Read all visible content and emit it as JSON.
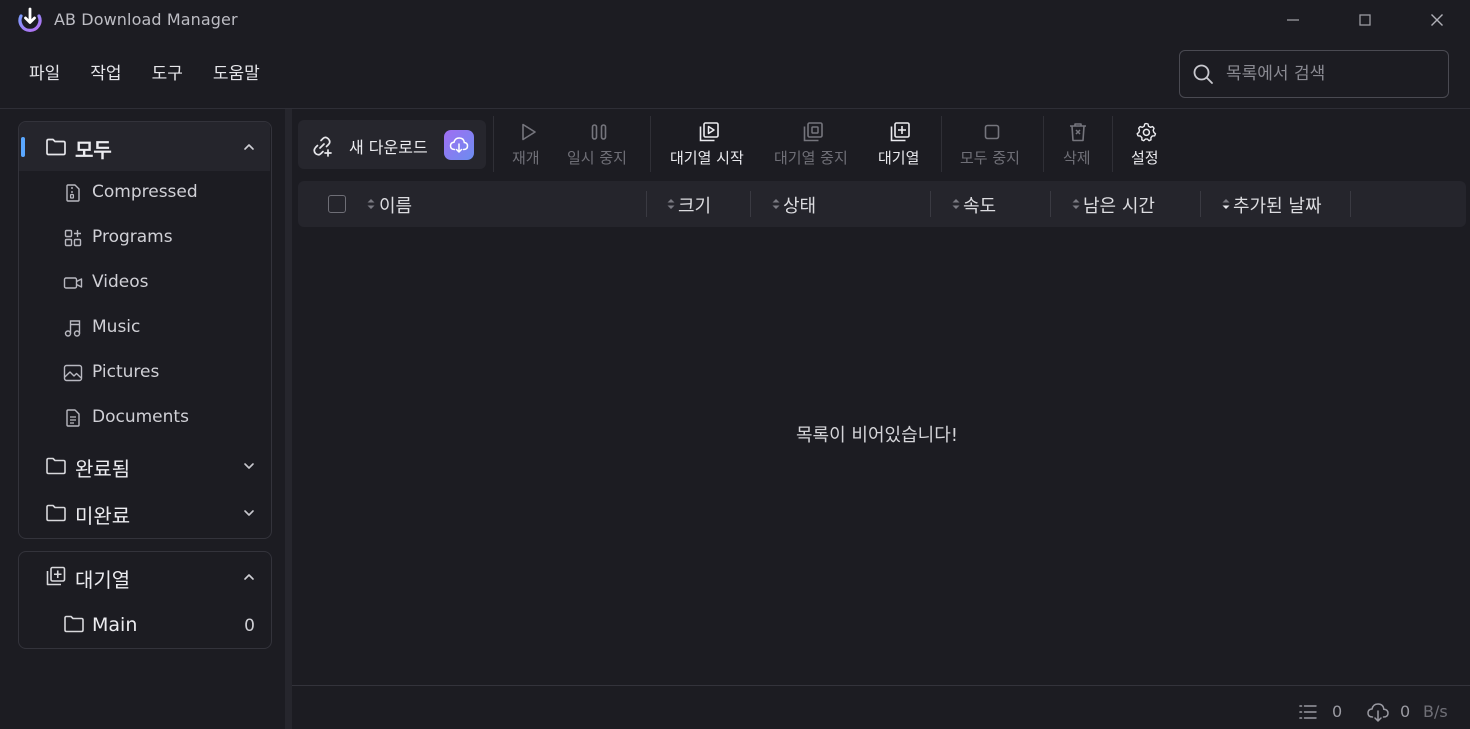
{
  "window": {
    "title": "AB Download Manager"
  },
  "menu": [
    "파일",
    "작업",
    "도구",
    "도움말"
  ],
  "search": {
    "placeholder": "목록에서 검색",
    "value": ""
  },
  "categories": {
    "all": {
      "label": "모두",
      "expanded": true,
      "items": [
        {
          "label": "Compressed",
          "icon": "file-zip-icon"
        },
        {
          "label": "Programs",
          "icon": "apps-grid-icon"
        },
        {
          "label": "Videos",
          "icon": "video-camera-icon"
        },
        {
          "label": "Music",
          "icon": "music-note-icon"
        },
        {
          "label": "Pictures",
          "icon": "image-icon"
        },
        {
          "label": "Documents",
          "icon": "document-icon"
        }
      ]
    },
    "finished": {
      "label": "완료됨",
      "expanded": false
    },
    "unfinished": {
      "label": "미완료",
      "expanded": false
    }
  },
  "queues": {
    "label": "대기열",
    "expanded": true,
    "items": [
      {
        "label": "Main",
        "count": "0"
      }
    ]
  },
  "toolbar": {
    "new_download": "새 다운로드",
    "resume": "재개",
    "pause": "일시 중지",
    "start_queue": "대기열 시작",
    "stop_queue": "대기열 중지",
    "queue": "대기열",
    "stop_all": "모두 중지",
    "delete": "삭제",
    "settings": "설정"
  },
  "table": {
    "columns": [
      "이름",
      "크기",
      "상태",
      "속도",
      "남은 시간",
      "추가된 날짜"
    ],
    "empty_message": "목록이 비어있습니다!"
  },
  "status": {
    "active_count": "0",
    "speed_value": "0",
    "speed_unit": "B/s"
  },
  "colors": {
    "background": "#1c1c22",
    "accent": "#5aa7ff",
    "brand_gradient_start": "#a06ef2",
    "brand_gradient_end": "#6b8df0"
  }
}
